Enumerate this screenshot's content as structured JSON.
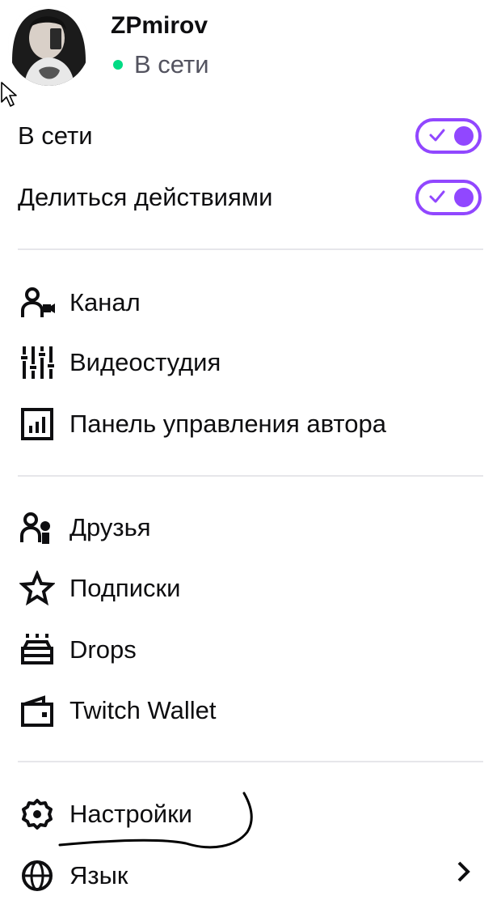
{
  "profile": {
    "username": "ZPmirov",
    "status": "В сети",
    "status_color": "#00db84"
  },
  "toggles": [
    {
      "label": "В сети",
      "checked": true
    },
    {
      "label": "Делиться действиями",
      "checked": true
    }
  ],
  "accent_color": "#9147ff",
  "menu": {
    "creator": [
      {
        "label": "Канал",
        "icon": "channel-icon"
      },
      {
        "label": "Видеостудия",
        "icon": "sliders-icon"
      },
      {
        "label": "Панель управления автора",
        "icon": "dashboard-icon"
      }
    ],
    "social": [
      {
        "label": "Друзья",
        "icon": "friends-icon"
      },
      {
        "label": "Подписки",
        "icon": "star-icon"
      },
      {
        "label": "Drops",
        "icon": "drops-icon"
      },
      {
        "label": "Twitch Wallet",
        "icon": "wallet-icon"
      }
    ],
    "settings": [
      {
        "label": "Настройки",
        "icon": "gear-icon"
      },
      {
        "label": "Язык",
        "icon": "globe-icon"
      }
    ]
  }
}
